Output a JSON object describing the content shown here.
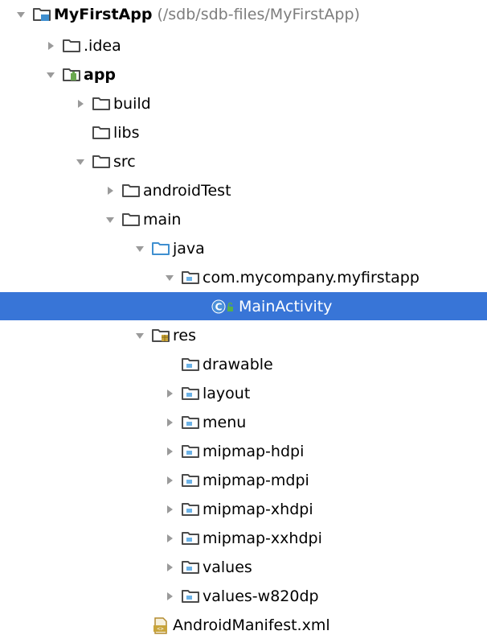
{
  "colors": {
    "selection": "#3875d7",
    "folder_outline": "#4b4b4b",
    "module_blue": "#3f8fd0",
    "source_blue": "#3f8fd0",
    "res_orange": "#c8a43a",
    "package_blue": "#6cb2e6",
    "path_gray": "#7d7d7d"
  },
  "tree": {
    "items": [
      {
        "label": "MyFirstApp",
        "path": "(/sdb/sdb-files/MyFirstApp)",
        "icon": "project-folder-icon",
        "expanded": true,
        "bold": true
      },
      {
        "label": ".idea",
        "icon": "folder-icon",
        "expanded": false
      },
      {
        "label": "app",
        "icon": "module-folder-icon",
        "expanded": true,
        "bold": true
      },
      {
        "label": "build",
        "icon": "folder-icon",
        "expanded": false
      },
      {
        "label": "libs",
        "icon": "folder-icon"
      },
      {
        "label": "src",
        "icon": "folder-icon",
        "expanded": true
      },
      {
        "label": "androidTest",
        "icon": "folder-icon",
        "expanded": false
      },
      {
        "label": "main",
        "icon": "folder-icon",
        "expanded": true
      },
      {
        "label": "java",
        "icon": "source-folder-icon",
        "expanded": true
      },
      {
        "label": "com.mycompany.myfirstapp",
        "icon": "package-icon",
        "expanded": true
      },
      {
        "label": "MainActivity",
        "icon": "class-icon",
        "selected": true
      },
      {
        "label": "res",
        "icon": "resource-folder-icon",
        "expanded": true
      },
      {
        "label": "drawable",
        "icon": "package-icon"
      },
      {
        "label": "layout",
        "icon": "package-icon",
        "expanded": false
      },
      {
        "label": "menu",
        "icon": "package-icon",
        "expanded": false
      },
      {
        "label": "mipmap-hdpi",
        "icon": "package-icon",
        "expanded": false
      },
      {
        "label": "mipmap-mdpi",
        "icon": "package-icon",
        "expanded": false
      },
      {
        "label": "mipmap-xhdpi",
        "icon": "package-icon",
        "expanded": false
      },
      {
        "label": "mipmap-xxhdpi",
        "icon": "package-icon",
        "expanded": false
      },
      {
        "label": "values",
        "icon": "package-icon",
        "expanded": false
      },
      {
        "label": "values-w820dp",
        "icon": "package-icon",
        "expanded": false
      },
      {
        "label": "AndroidManifest.xml",
        "icon": "manifest-file-icon"
      }
    ]
  }
}
